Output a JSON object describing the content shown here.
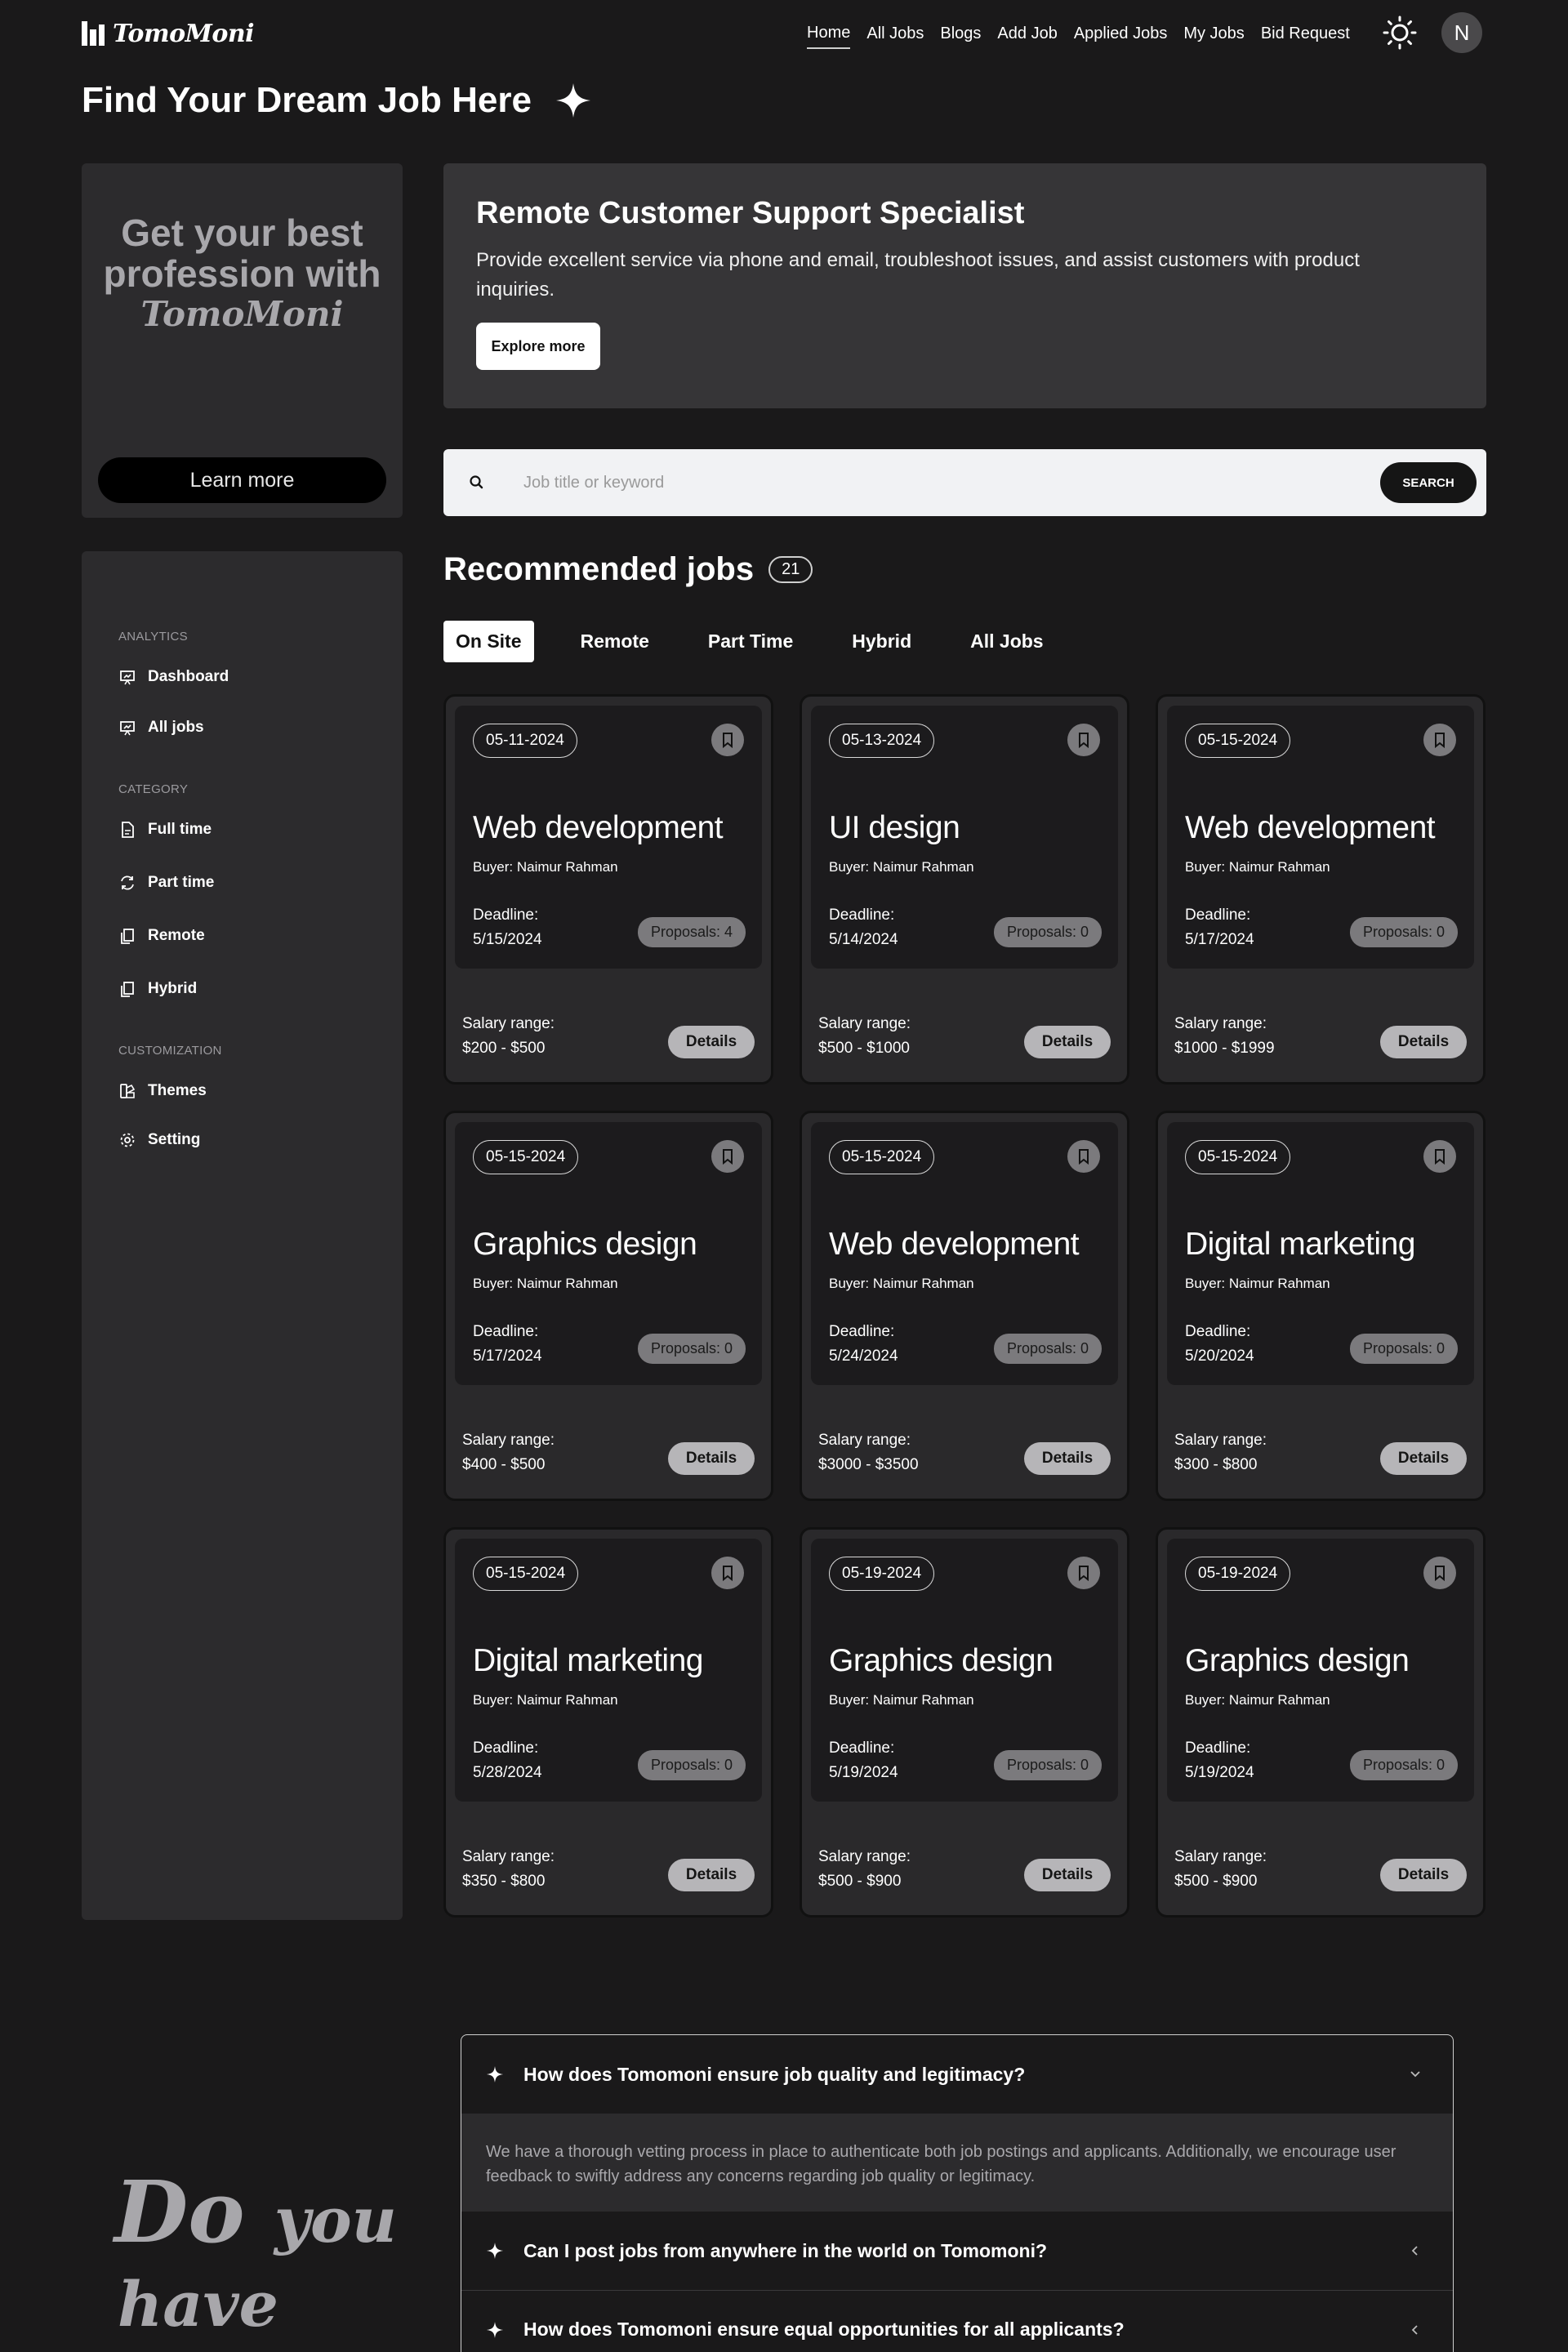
{
  "brand": {
    "name": "TomoMoni"
  },
  "nav": {
    "items": [
      {
        "label": "Home",
        "active": true
      },
      {
        "label": "All Jobs"
      },
      {
        "label": "Blogs"
      },
      {
        "label": "Add Job"
      },
      {
        "label": "Applied Jobs"
      },
      {
        "label": "My Jobs"
      },
      {
        "label": "Bid Request"
      }
    ],
    "avatar_initial": "N"
  },
  "page_title": "Find Your Dream Job Here",
  "promo": {
    "line1": "Get your best",
    "line2": "profession with",
    "brand": "TomoMoni",
    "button": "Learn more"
  },
  "hero": {
    "title": "Remote Customer Support Specialist",
    "description": "Provide excellent service via phone and email, troubleshoot issues, and assist customers with product inquiries.",
    "button": "Explore more"
  },
  "search": {
    "placeholder": "Job title or keyword",
    "button": "SEARCH"
  },
  "sidebar": {
    "sections": [
      {
        "label": "ANALYTICS"
      },
      {
        "label": "CATEGORY"
      },
      {
        "label": "CUSTOMIZATION"
      }
    ],
    "items": [
      {
        "label": "Dashboard",
        "icon": "presentation-icon"
      },
      {
        "label": "All jobs",
        "icon": "presentation-icon"
      },
      {
        "label": "Full time",
        "icon": "file-icon"
      },
      {
        "label": "Part time",
        "icon": "refresh-icon"
      },
      {
        "label": "Remote",
        "icon": "copy-icon"
      },
      {
        "label": "Hybrid",
        "icon": "copy-icon"
      },
      {
        "label": "Themes",
        "icon": "palette-icon"
      },
      {
        "label": "Setting",
        "icon": "gear-icon"
      }
    ]
  },
  "recommended": {
    "title": "Recommended jobs",
    "count": "21",
    "tabs": [
      {
        "label": "On Site",
        "active": true
      },
      {
        "label": "Remote"
      },
      {
        "label": "Part Time"
      },
      {
        "label": "Hybrid"
      },
      {
        "label": "All Jobs"
      }
    ]
  },
  "labels": {
    "deadline": "Deadline:",
    "salary": "Salary range:",
    "details": "Details"
  },
  "jobs": [
    {
      "date": "05-11-2024",
      "title": "Web development",
      "buyer": "Buyer: Naimur Rahman",
      "deadline": "5/15/2024",
      "proposals": "Proposals: 4",
      "salary": "$200 - $500"
    },
    {
      "date": "05-13-2024",
      "title": "UI design",
      "buyer": "Buyer: Naimur Rahman",
      "deadline": "5/14/2024",
      "proposals": "Proposals: 0",
      "salary": "$500 - $1000"
    },
    {
      "date": "05-15-2024",
      "title": "Web development",
      "buyer": "Buyer: Naimur Rahman",
      "deadline": "5/17/2024",
      "proposals": "Proposals: 0",
      "salary": "$1000 - $1999"
    },
    {
      "date": "05-15-2024",
      "title": "Graphics design",
      "buyer": "Buyer: Naimur Rahman",
      "deadline": "5/17/2024",
      "proposals": "Proposals: 0",
      "salary": "$400 - $500"
    },
    {
      "date": "05-15-2024",
      "title": "Web development",
      "buyer": "Buyer: Naimur Rahman",
      "deadline": "5/24/2024",
      "proposals": "Proposals: 0",
      "salary": "$3000 - $3500"
    },
    {
      "date": "05-15-2024",
      "title": "Digital marketing",
      "buyer": "Buyer: Naimur Rahman",
      "deadline": "5/20/2024",
      "proposals": "Proposals: 0",
      "salary": "$300 - $800"
    },
    {
      "date": "05-15-2024",
      "title": "Digital marketing",
      "buyer": "Buyer: Naimur Rahman",
      "deadline": "5/28/2024",
      "proposals": "Proposals: 0",
      "salary": "$350 - $800"
    },
    {
      "date": "05-19-2024",
      "title": "Graphics design",
      "buyer": "Buyer: Naimur Rahman",
      "deadline": "5/19/2024",
      "proposals": "Proposals: 0",
      "salary": "$500 - $900"
    },
    {
      "date": "05-19-2024",
      "title": "Graphics design",
      "buyer": "Buyer: Naimur Rahman",
      "deadline": "5/19/2024",
      "proposals": "Proposals: 0",
      "salary": "$500 - $900"
    }
  ],
  "faq": {
    "items": [
      {
        "question": "How does Tomomoni ensure job quality and legitimacy?",
        "answer": "We have a thorough vetting process in place to authenticate both job postings and applicants. Additionally, we encourage user feedback to swiftly address any concerns regarding job quality or legitimacy.",
        "expanded": true
      },
      {
        "question": "Can I post jobs from anywhere in the world on Tomomoni?"
      },
      {
        "question": "How does Tomomoni ensure equal opportunities for all applicants?"
      }
    ],
    "side_heading": {
      "word1": "Do",
      "word2": "you",
      "line2": "have any"
    }
  },
  "colors": {
    "background": "#1a191a",
    "panel": "#2c2b2d",
    "hero": "#363537",
    "card": "#2a292b",
    "card_inner": "#1c1b1d"
  }
}
